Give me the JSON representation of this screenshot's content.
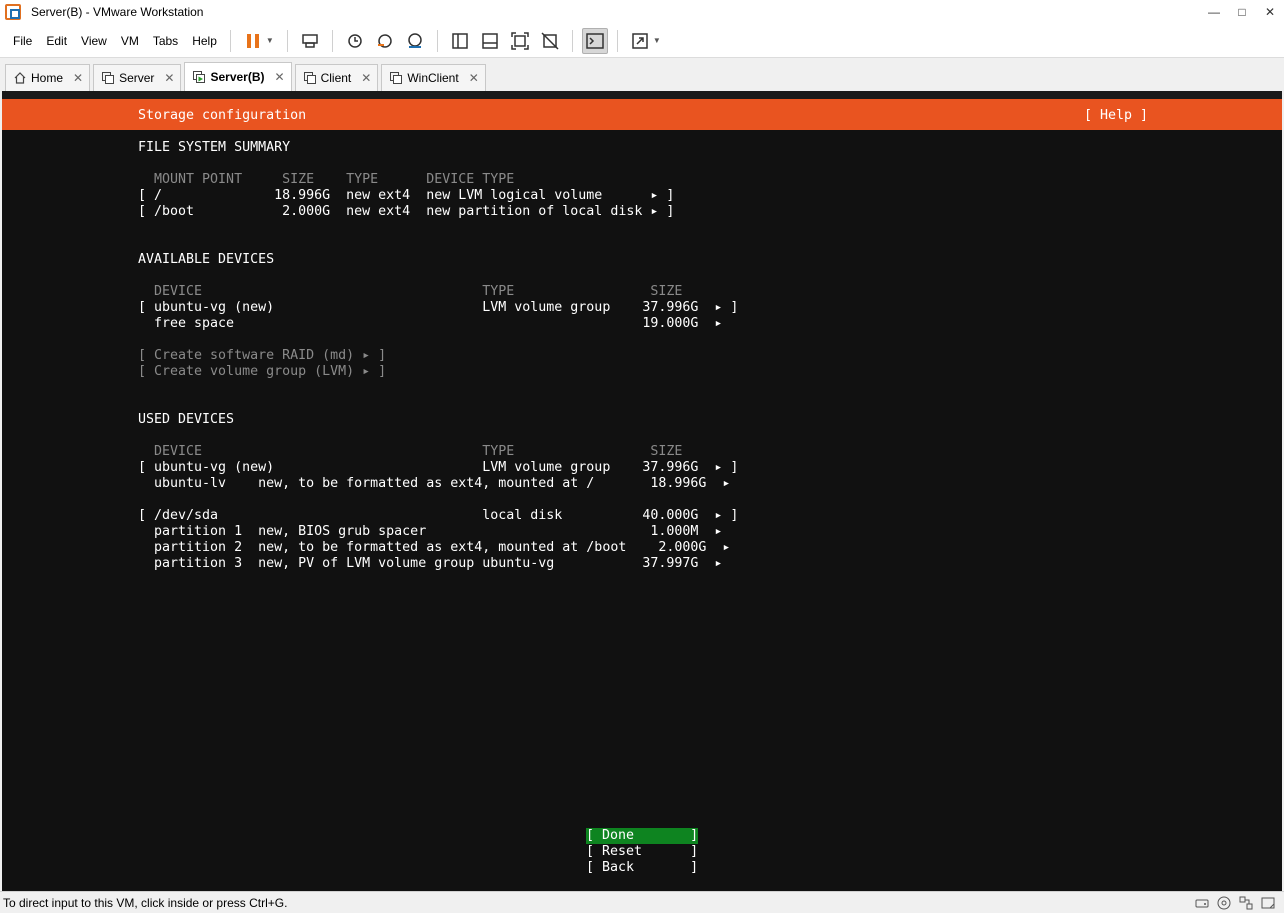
{
  "window": {
    "title": "Server(B) - VMware Workstation"
  },
  "menu": [
    "File",
    "Edit",
    "View",
    "VM",
    "Tabs",
    "Help"
  ],
  "tabs": [
    {
      "label": "Home"
    },
    {
      "label": "Server"
    },
    {
      "label": "Server(B)"
    },
    {
      "label": "Client"
    },
    {
      "label": "WinClient"
    }
  ],
  "installer": {
    "header_title": "Storage configuration",
    "help_button": "[ Help ]",
    "fs_summary": {
      "heading": "FILE SYSTEM SUMMARY",
      "columns": "  MOUNT POINT     SIZE    TYPE      DEVICE TYPE",
      "rows": [
        "[ /              18.996G  new ext4  new LVM logical volume      ▸ ]",
        "[ /boot           2.000G  new ext4  new partition of local disk ▸ ]"
      ]
    },
    "available": {
      "heading": "AVAILABLE DEVICES",
      "columns": "  DEVICE                                   TYPE                 SIZE",
      "rows": [
        "[ ubuntu-vg (new)                          LVM volume group    37.996G  ▸ ]",
        "  free space                                                   19.000G  ▸"
      ],
      "actions": [
        "[ Create software RAID (md) ▸ ]",
        "[ Create volume group (LVM) ▸ ]"
      ]
    },
    "used": {
      "heading": "USED DEVICES",
      "columns": "  DEVICE                                   TYPE                 SIZE",
      "rows": [
        "[ ubuntu-vg (new)                          LVM volume group    37.996G  ▸ ]",
        "  ubuntu-lv    new, to be formatted as ext4, mounted at /       18.996G  ▸",
        "",
        "[ /dev/sda                                 local disk          40.000G  ▸ ]",
        "  partition 1  new, BIOS grub spacer                            1.000M  ▸",
        "  partition 2  new, to be formatted as ext4, mounted at /boot    2.000G  ▸",
        "  partition 3  new, PV of LVM volume group ubuntu-vg           37.997G  ▸"
      ]
    },
    "buttons": {
      "done": "[ Done       ]",
      "reset": "[ Reset      ]",
      "back": "[ Back       ]"
    }
  },
  "status": {
    "text": "To direct input to this VM, click inside or press Ctrl+G."
  },
  "colors": {
    "accent": "#e95420",
    "selected": "#0e8420"
  }
}
